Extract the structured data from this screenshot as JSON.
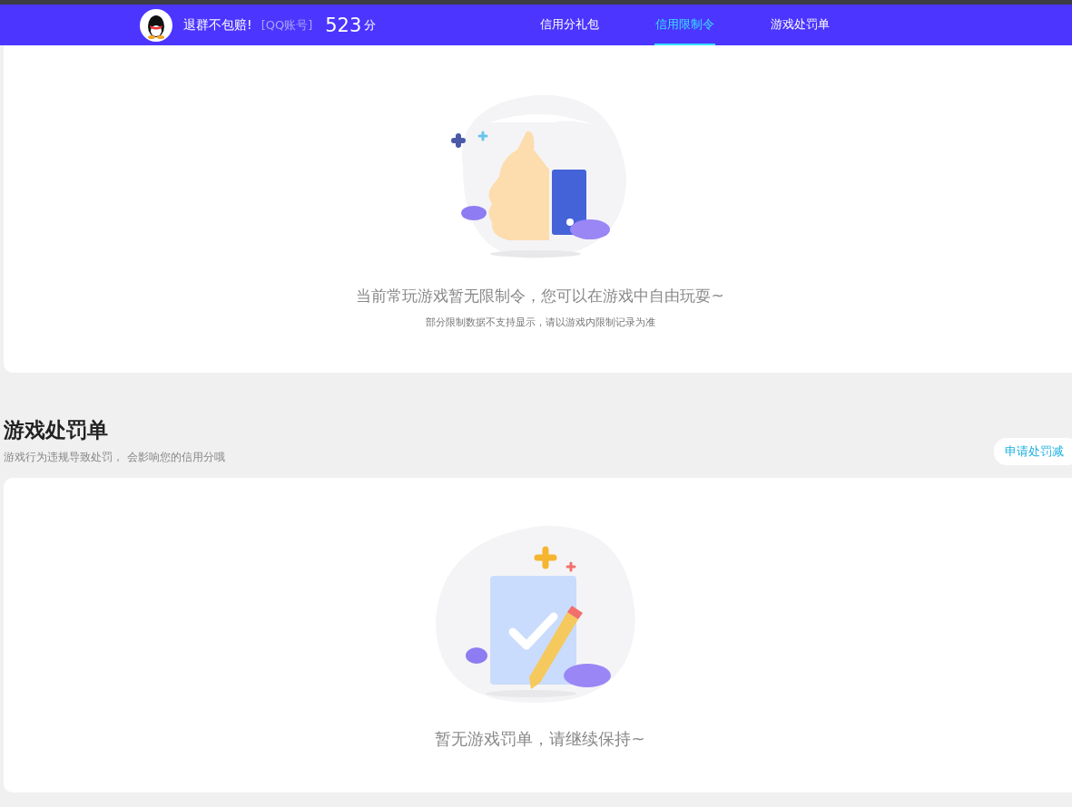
{
  "header": {
    "nickname": "退群不包赔!",
    "account_label": "[QQ账号]",
    "score": "523",
    "score_unit": "分",
    "tabs": [
      {
        "label": "信用分礼包",
        "selected": false
      },
      {
        "label": "信用限制令",
        "selected": true
      },
      {
        "label": "游戏处罚单",
        "selected": false
      }
    ]
  },
  "restriction_card": {
    "message": "当前常玩游戏暂无限制令，您可以在游戏中自由玩耍~",
    "note": "部分限制数据不支持显示，请以游戏内限制记录为准"
  },
  "penalty_section": {
    "title": "游戏处罚单",
    "subtitle": "游戏行为违规导致处罚， 会影响您的信用分哦",
    "action": "申请处罚减",
    "message": "暂无游戏罚单，请继续保持~"
  }
}
